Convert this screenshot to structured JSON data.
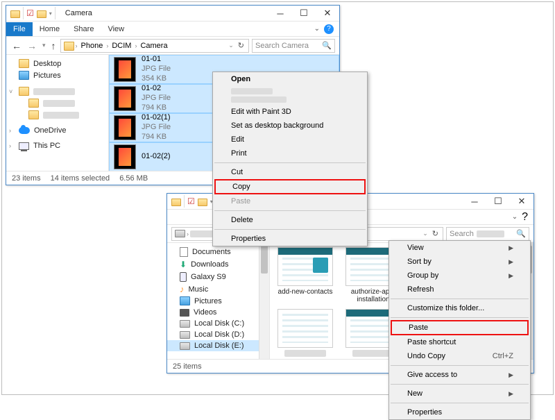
{
  "window1": {
    "title": "Camera",
    "ribbon": {
      "file": "File",
      "home": "Home",
      "share": "Share",
      "view": "View"
    },
    "breadcrumb": [
      "Phone",
      "DCIM",
      "Camera"
    ],
    "search_placeholder": "Search Camera",
    "nav": {
      "desktop": "Desktop",
      "pictures": "Pictures",
      "onedrive": "OneDrive",
      "thispc": "This PC"
    },
    "files": [
      {
        "name": "01-01",
        "type": "JPG File",
        "size": "354 KB"
      },
      {
        "name": "01-02",
        "type": "JPG File",
        "size": "794 KB"
      },
      {
        "name": "01-02(1)",
        "type": "JPG File",
        "size": "794 KB"
      },
      {
        "name": "01-02(2)",
        "type": "",
        "size": ""
      }
    ],
    "status": {
      "items": "23 items",
      "selected": "14 items selected",
      "size": "6.56 MB"
    }
  },
  "window2": {
    "search_placeholder": "Search",
    "nav": {
      "documents": "Documents",
      "downloads": "Downloads",
      "galaxy": "Galaxy S9",
      "music": "Music",
      "pictures": "Pictures",
      "videos": "Videos",
      "diskc": "Local Disk (C:)",
      "diskd": "Local Disk (D:)",
      "diske": "Local Disk (E:)"
    },
    "thumbs": [
      {
        "label": "add-new-contacts"
      },
      {
        "label": "authorize-app-installation"
      },
      {
        "label": ""
      },
      {
        "label": ""
      },
      {
        "label": ""
      }
    ],
    "status": {
      "items": "25 items"
    }
  },
  "ctx1": {
    "open": "Open",
    "edit3d": "Edit with Paint 3D",
    "setbg": "Set as desktop background",
    "edit": "Edit",
    "print": "Print",
    "cut": "Cut",
    "copy": "Copy",
    "paste": "Paste",
    "delete": "Delete",
    "properties": "Properties"
  },
  "ctx2": {
    "view": "View",
    "sortby": "Sort by",
    "groupby": "Group by",
    "refresh": "Refresh",
    "customize": "Customize this folder...",
    "paste": "Paste",
    "pastesc": "Paste shortcut",
    "undocopy": "Undo Copy",
    "undoshort": "Ctrl+Z",
    "giveaccess": "Give access to",
    "new": "New",
    "properties": "Properties"
  }
}
